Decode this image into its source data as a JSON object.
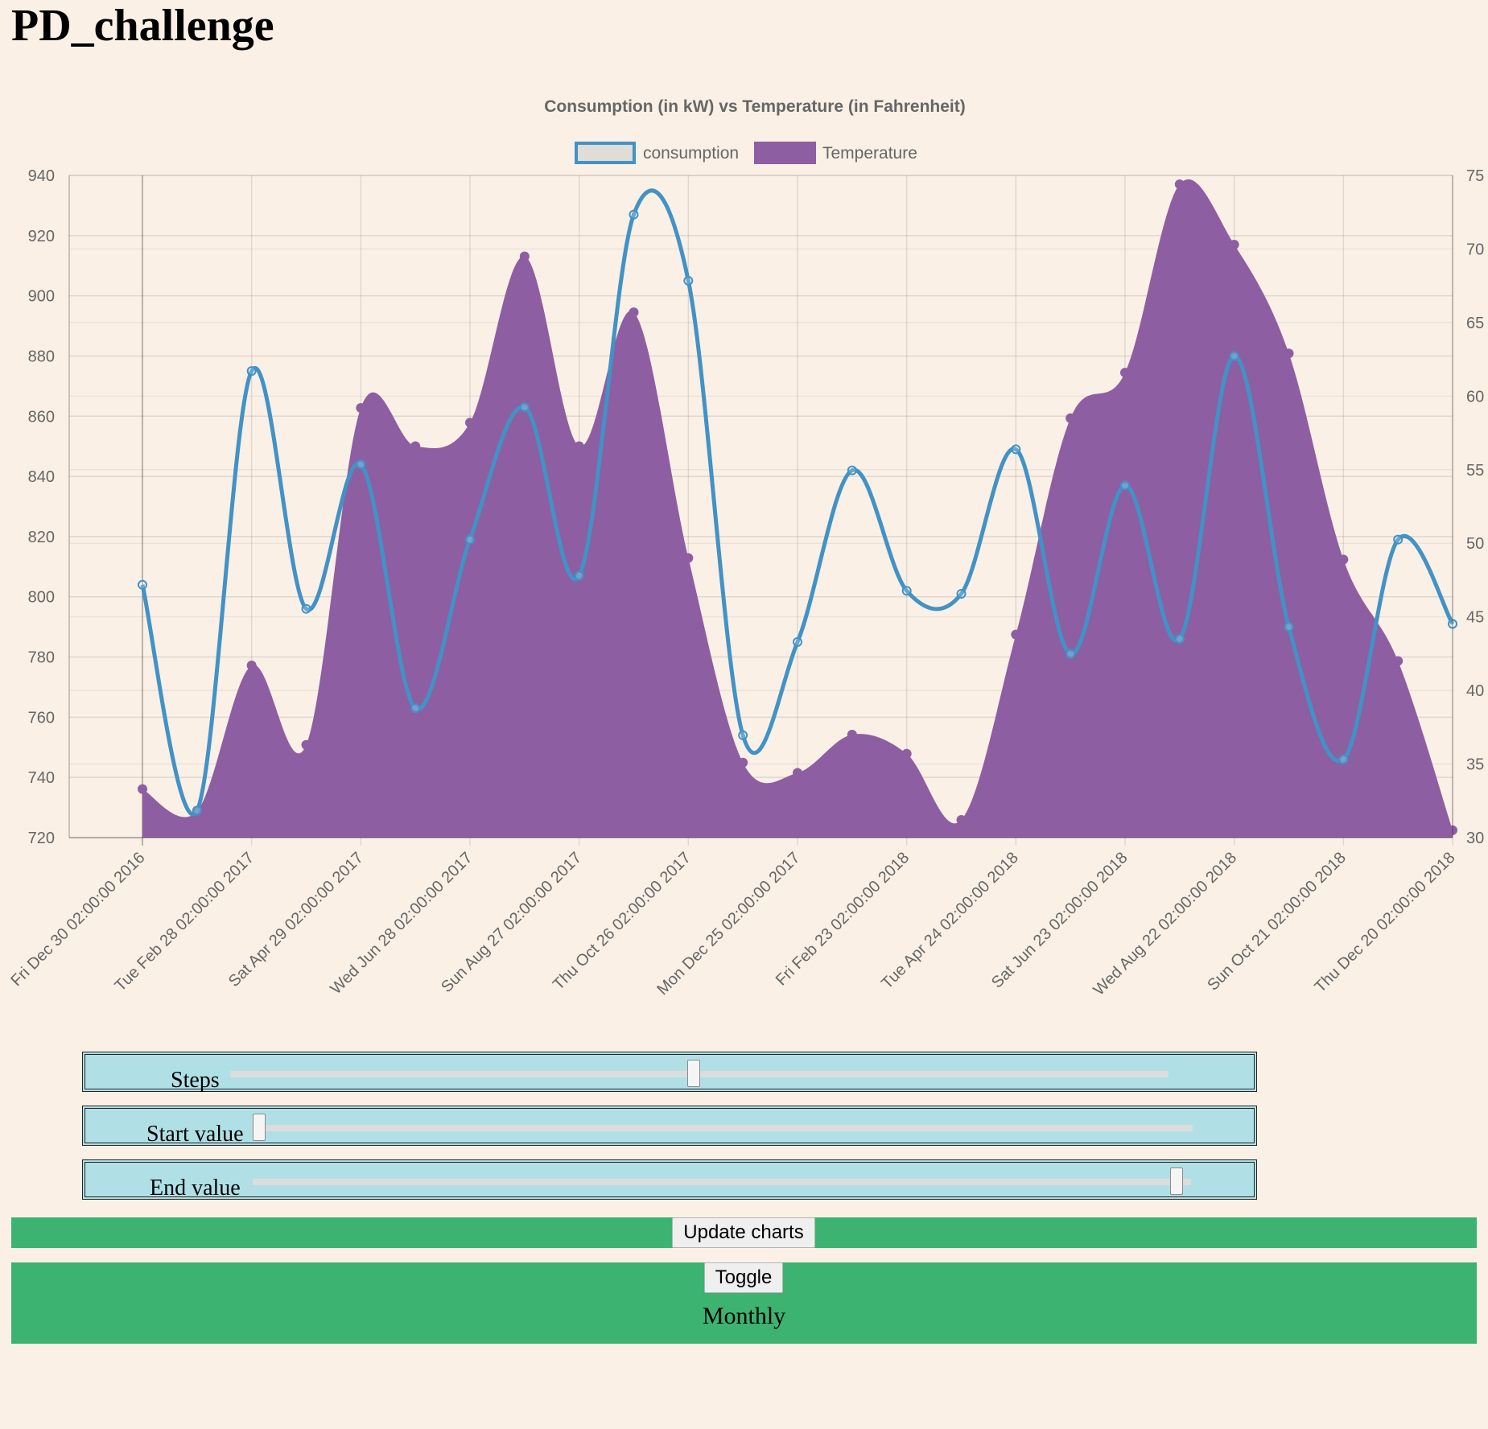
{
  "page": {
    "title": "PD_challenge"
  },
  "chart_data": {
    "type": "line",
    "title": "Consumption (in kW) vs Temperature (in Fahrenheit)",
    "legend": {
      "position": "top"
    },
    "x_ticks": [
      "Fri Dec 30 02:00:00 2016",
      "Tue Feb 28 02:00:00 2017",
      "Sat Apr 29 02:00:00 2017",
      "Wed Jun 28 02:00:00 2017",
      "Sun Aug 27 02:00:00 2017",
      "Thu Oct 26 02:00:00 2017",
      "Mon Dec 25 02:00:00 2017",
      "Fri Feb 23 02:00:00 2018",
      "Tue Apr 24 02:00:00 2018",
      "Sat Jun 23 02:00:00 2018",
      "Wed Aug 22 02:00:00 2018",
      "Sun Oct 21 02:00:00 2018",
      "Thu Dec 20 02:00:00 2018"
    ],
    "x": [
      0,
      0.5,
      1,
      1.5,
      2,
      2.5,
      3,
      3.5,
      4,
      4.5,
      5,
      5.5,
      6,
      6.5,
      7,
      7.5,
      8,
      8.5,
      9,
      9.5,
      10,
      10.5,
      11,
      11.5,
      12
    ],
    "y_left": {
      "min": 720,
      "max": 940,
      "ticks": [
        720,
        740,
        760,
        780,
        800,
        820,
        840,
        860,
        880,
        900,
        920,
        940
      ]
    },
    "y_right": {
      "min": 30,
      "max": 75,
      "ticks": [
        30,
        35,
        40,
        45,
        50,
        55,
        60,
        65,
        70,
        75
      ]
    },
    "grid": true,
    "series": [
      {
        "name": "consumption",
        "axis": "left",
        "style": "line",
        "color": "#4292c6",
        "values": [
          804,
          729,
          875,
          796,
          844,
          763,
          819,
          863,
          807,
          927,
          905,
          754,
          785,
          842,
          802,
          801,
          849,
          781,
          837,
          786,
          880,
          790,
          746,
          819,
          791
        ]
      },
      {
        "name": "Temperature",
        "axis": "right",
        "style": "area",
        "color": "#8e5ea2",
        "values": [
          33.3,
          31.8,
          41.7,
          36.3,
          59.2,
          56.6,
          58.2,
          69.5,
          56.6,
          65.7,
          49.0,
          35.1,
          34.4,
          37.0,
          35.7,
          31.2,
          43.8,
          58.5,
          61.6,
          74.4,
          70.3,
          62.9,
          48.9,
          42.0,
          30.5
        ]
      }
    ]
  },
  "controls": {
    "steps": {
      "label": "Steps",
      "value_fraction": 0.5
    },
    "start": {
      "label": "Start value",
      "value_fraction": 0.0
    },
    "end": {
      "label": "End value",
      "value_fraction": 1.0
    },
    "update_button": "Update charts",
    "toggle_button": "Toggle",
    "mode_label": "Monthly"
  },
  "colors": {
    "background": "#faf0e6",
    "slider_panel": "#b0e0e6",
    "button_bar": "#3cb371",
    "legend_consumption_fill": "#e0dcd6"
  }
}
